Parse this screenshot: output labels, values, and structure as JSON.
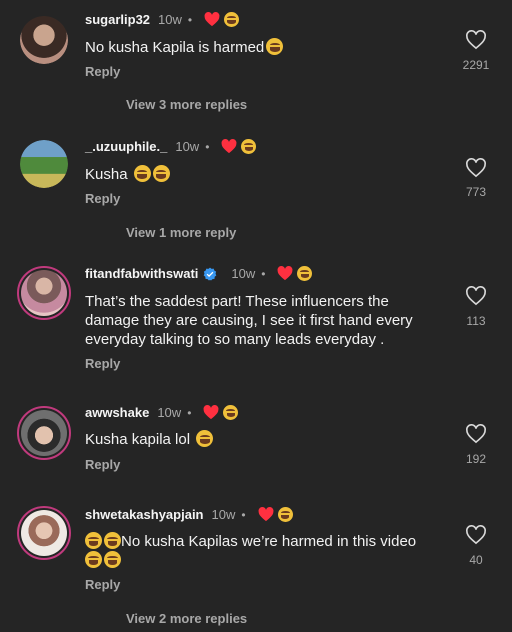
{
  "comments": [
    {
      "username": "sugarlip32",
      "time": "10w",
      "dot": "•",
      "text": "No kusha Kapila is harmed",
      "text_emoji_count": 1,
      "reply": "Reply",
      "likes": "2291",
      "view_more": "View 3 more replies"
    },
    {
      "username": "_.uzuuphile._",
      "time": "10w",
      "dot": "•",
      "text": "Kusha",
      "text_emoji_count": 2,
      "reply": "Reply",
      "likes": "773",
      "view_more": "View 1 more reply"
    },
    {
      "username": "fitandfabwithswati",
      "time": "10w",
      "dot": "•",
      "verified": true,
      "text_line1": "That’s the saddest part! These influencers the",
      "text_line2": "damage they are causing, I see it first hand every",
      "text_line3": "everyday talking to so many leads everyday .",
      "reply": "Reply",
      "likes": "113"
    },
    {
      "username": "awwshake",
      "time": "10w",
      "dot": "•",
      "text": "Kusha kapila lol",
      "text_emoji_count": 1,
      "reply": "Reply",
      "likes": "192"
    },
    {
      "username": "shwetakashyapjain",
      "time": "10w",
      "dot": "•",
      "text": "No kusha Kapilas we’re harmed in this video",
      "reply": "Reply",
      "likes": "40",
      "view_more": "View 2 more replies"
    }
  ],
  "colors": {
    "background": "#252525",
    "heart_liked": "#ff3040",
    "secondary_text": "#a8a8a8",
    "story_ring": "#c03a7d",
    "verified": "#3897f0"
  },
  "icons": {
    "liked_by_creator": "red-heart-icon",
    "creator_avatar_badge": "laughing-emoji",
    "like": "heart-outline-icon",
    "verified": "verified-badge-icon"
  }
}
